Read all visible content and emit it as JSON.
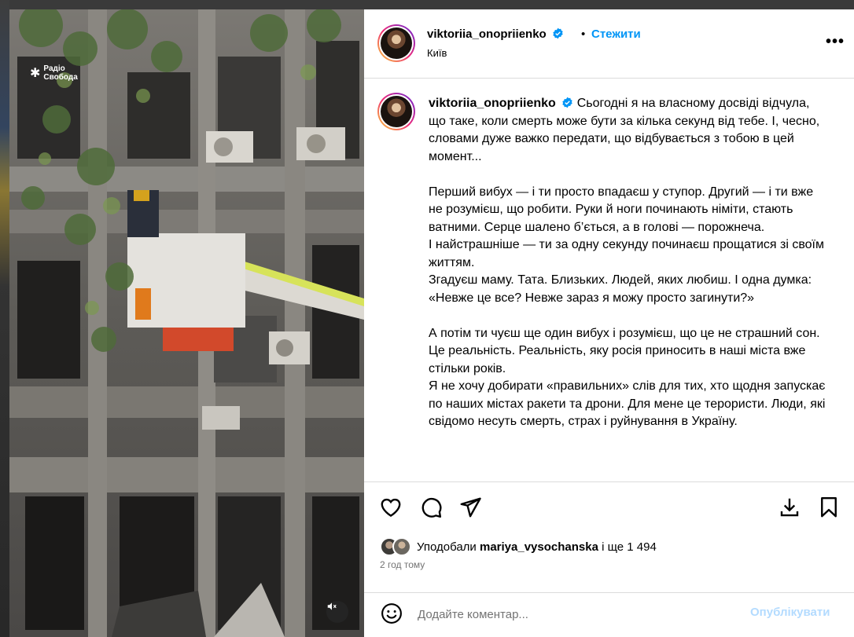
{
  "post": {
    "username": "viktoriia_onopriienko",
    "follow_label": "Стежити",
    "separator": "•",
    "location": "Київ",
    "more_label": "•••",
    "caption_username": "viktoriia_onopriienko",
    "caption_paragraphs": [
      "Сьогодні я на власному досвіді відчула, що таке, коли смерть може бути за кілька секунд від тебе. І, чесно, словами дуже важко передати, що відбувається з тобою в цей момент...",
      "",
      "Перший вибух — і ти просто впадаєш у ступор. Другий — і ти вже не розумієш, що робити. Руки й ноги починають німіти, стають ватними. Серце шалено б’ється, а в голові — порожнеча.",
      "І найстрашніше — ти за одну секунду починаєш прощатися зі своїм життям.",
      "Згадуєш маму. Тата. Близьких. Людей, яких любиш. І одна думка: «Невже це все? Невже зараз я можу просто загинути?»",
      "",
      "А потім ти чуєш ще один вибух і розумієш, що це не страшний сон. Це реальність. Реальність, яку росія приносить в наші міста вже стільки років.",
      "Я не хочу добирати «правильних» слів для тих, хто щодня запускає по наших містах ракети та дрони. Для мене це терористи. Люди, які свідомо несуть смерть, страх і руйнування в Україну."
    ],
    "likes": {
      "prefix": "Уподобали",
      "user": "mariya_vysochanska",
      "suffix": "і ще 1 494"
    },
    "time_ago": "2 год тому",
    "comment": {
      "placeholder": "Додайте коментар...",
      "value": "",
      "post_label": "Опублікувати"
    }
  },
  "media": {
    "watermark": [
      "Радіо",
      "Свобода"
    ]
  },
  "icons": {
    "verified": "verified-badge-icon",
    "like": "heart-icon",
    "comment": "comment-icon",
    "share": "paper-plane-icon",
    "save": "bookmark-icon",
    "download": "download-icon",
    "emoji": "smiley-icon",
    "mute": "speaker-muted-icon"
  },
  "colors": {
    "accent": "#0095f6",
    "post_disabled": "#b3dbff",
    "muted_text": "#737373",
    "border": "#dbdbdb"
  }
}
